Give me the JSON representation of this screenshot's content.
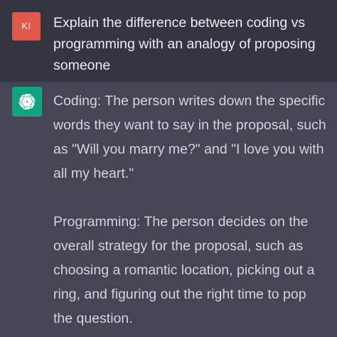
{
  "user_message": {
    "avatar_initials": "KI",
    "avatar_color": "#df5a4a",
    "text": "Explain the difference between coding vs programming with an analogy of proposing someone"
  },
  "assistant_message": {
    "avatar_icon": "chatgpt-logo-icon",
    "avatar_color": "#10a37f",
    "paragraphs": [
      "Coding: The person writes down the specific words they want to say in the proposal, such as \"Will you marry me?\" and \"I love you with all my heart.\"",
      "Programming: The person decides on the overall strategy for the proposal, such as choosing a romantic location, picking out a ring, and figuring out the right time to pop the question."
    ]
  }
}
